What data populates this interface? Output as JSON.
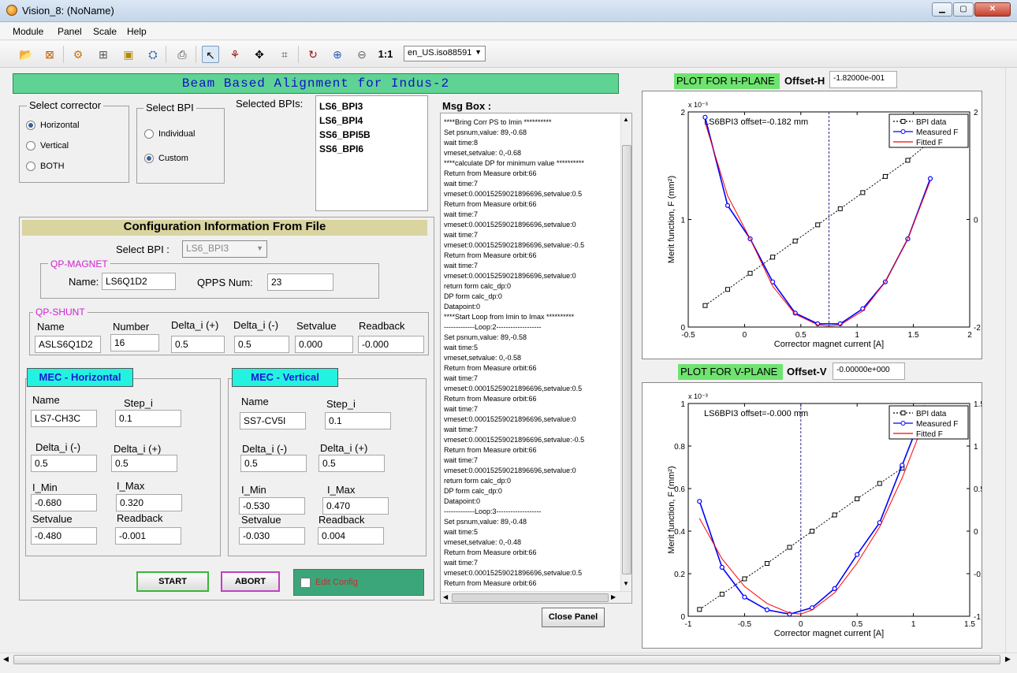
{
  "window": {
    "title": "Vision_8: (NoName)"
  },
  "menu": [
    "Module",
    "Panel",
    "Scale",
    "Help"
  ],
  "toolbar": {
    "zoom_label": "1:1",
    "locale": "en_US.iso88591"
  },
  "header": {
    "title": "Beam Based Alignment for Indus-2"
  },
  "corrector": {
    "title": "Select corrector",
    "options": [
      "Horizontal",
      "Vertical",
      "BOTH"
    ]
  },
  "bpi_select": {
    "title": "Select BPI",
    "options": [
      "Individual",
      "Custom"
    ]
  },
  "selected_bpis": {
    "label": "Selected BPIs:",
    "items": [
      "LS6_BPI3",
      "LS6_BPI4",
      "SS6_BPI5B",
      "SS6_BPI6"
    ]
  },
  "config": {
    "title": "Configuration Information From File",
    "select_bpi_label": "Select BPI :",
    "select_bpi_value": "LS6_BPI3",
    "qp_magnet": {
      "title": "QP-MAGNET",
      "name_label": "Name:",
      "name": "LS6Q1D2",
      "qpps_label": "QPPS Num:",
      "qpps": "23"
    },
    "qp_shunt": {
      "title": "QP-SHUNT",
      "headers": [
        "Name",
        "Number",
        "Delta_i (+)",
        "Delta_i (-)",
        "Setvalue",
        "Readback"
      ],
      "values": [
        "ASLS6Q1D2",
        "16",
        "0.5",
        "0.5",
        "0.000",
        "-0.000"
      ]
    },
    "mec_h": {
      "title": "MEC - Horizontal",
      "name_label": "Name",
      "name": "LS7-CH3C",
      "step_label": "Step_i",
      "step": "0.1",
      "dminus_label": "Delta_i (-)",
      "dminus": "0.5",
      "dplus_label": "Delta_i (+)",
      "dplus": "0.5",
      "imin_label": "I_Min",
      "imin": "-0.680",
      "imax_label": "I_Max",
      "imax": "0.320",
      "set_label": "Setvalue",
      "set": "-0.480",
      "rb_label": "Readback",
      "rb": "-0.001"
    },
    "mec_v": {
      "title": "MEC - Vertical",
      "name_label": "Name",
      "name": "SS7-CV5I",
      "step_label": "Step_i",
      "step": "0.1",
      "dminus_label": "Delta_i (-)",
      "dminus": "0.5",
      "dplus_label": "Delta_i (+)",
      "dplus": "0.5",
      "imin_label": "I_Min",
      "imin": "-0.530",
      "imax_label": "I_Max",
      "imax": "0.470",
      "set_label": "Setvalue",
      "set": "-0.030",
      "rb_label": "Readback",
      "rb": "0.004"
    }
  },
  "actions": {
    "start": "START",
    "abort": "ABORT",
    "edit_config": "Edit Config",
    "close": "Close Panel"
  },
  "msgbox": {
    "label": "Msg Box :",
    "lines": [
      "****Bring Corr PS to Imin **********",
      "Set psnum,value: 89,-0.68",
      "wait time:8",
      "vmeset,setvalue: 0,-0.68",
      "****calculate DP for minimum value **********",
      "Return from Measure orbit:66",
      "wait time:7",
      "vmeset:0.00015259021896696,setvalue:0.5",
      "Return from Measure orbit:66",
      "wait time:7",
      "vmeset:0.00015259021896696,setvalue:0",
      "wait time:7",
      "vmeset:0.00015259021896696,setvalue:-0.5",
      "Return from Measure orbit:66",
      "wait time:7",
      "vmeset:0.00015259021896696,setvalue:0",
      "return form calc_dp:0",
      "DP form calc_dp:0",
      "Datapoint:0",
      "****Start Loop from Imin to Imax **********",
      "-------------Loop:2-------------------",
      "Set psnum,value: 89,-0.58",
      "wait time:5",
      "vmeset,setvalue: 0,-0.58",
      "Return from Measure orbit:66",
      "wait time:7",
      "vmeset:0.00015259021896696,setvalue:0.5",
      "Return from Measure orbit:66",
      "wait time:7",
      "vmeset:0.00015259021896696,setvalue:0",
      "wait time:7",
      "vmeset:0.00015259021896696,setvalue:-0.5",
      "Return from Measure orbit:66",
      "wait time:7",
      "vmeset:0.00015259021896696,setvalue:0",
      "return form calc_dp:0",
      "DP form calc_dp:0",
      "Datapoint:0",
      "-------------Loop:3-------------------",
      "Set psnum,value: 89,-0.48",
      "wait time:5",
      "vmeset,setvalue: 0,-0.48",
      "Return from Measure orbit:66",
      "wait time:7",
      "vmeset:0.00015259021896696,setvalue:0.5",
      "Return from Measure orbit:66"
    ]
  },
  "h_plane": {
    "tag": "PLOT FOR H-PLANE",
    "offset_label": "Offset-H",
    "offset": "-1.82000e-001"
  },
  "v_plane": {
    "tag": "PLOT FOR V-PLANE",
    "offset_label": "Offset-V",
    "offset": "-0.00000e+000"
  },
  "chart_data": [
    {
      "type": "line",
      "annotation": "LS6BPI3 offset=-0.182 mm",
      "xlabel": "Corrector magnet current [A]",
      "ylabel": "Merit function, F (mm²)",
      "y2label": "BPI data [mm]",
      "xlim": [
        -0.5,
        2
      ],
      "ylim": [
        0,
        2
      ],
      "y2lim": [
        -2,
        2
      ],
      "yexp": "x 10⁻³",
      "xticks": [
        "-0.5",
        "0",
        "0.5",
        "1",
        "1.5",
        "2"
      ],
      "yticks": [
        "0",
        "1",
        "2"
      ],
      "y2ticks": [
        "-2",
        "0",
        "2"
      ],
      "offset_x": 0.75,
      "legend": [
        "BPI data",
        "Measured F",
        "Fitted F"
      ],
      "legend_position": "top-right",
      "colors": {
        "bpi": "#000000",
        "measured": "#0000ff",
        "fitted": "#ff0000"
      },
      "series": [
        {
          "name": "BPI data",
          "axis": "y2",
          "x": [
            -0.35,
            -0.15,
            0.05,
            0.25,
            0.45,
            0.65,
            0.85,
            1.05,
            1.25,
            1.45,
            1.65
          ],
          "y": [
            -1.6,
            -1.3,
            -1.0,
            -0.7,
            -0.4,
            -0.1,
            0.2,
            0.5,
            0.8,
            1.1,
            1.45
          ]
        },
        {
          "name": "Measured F",
          "axis": "y",
          "x": [
            -0.35,
            -0.15,
            0.05,
            0.25,
            0.45,
            0.65,
            0.85,
            1.05,
            1.25,
            1.45,
            1.65
          ],
          "y": [
            1.95,
            1.13,
            0.82,
            0.42,
            0.13,
            0.03,
            0.03,
            0.17,
            0.42,
            0.82,
            1.38
          ]
        },
        {
          "name": "Fitted F",
          "axis": "y",
          "x": [
            -0.35,
            -0.15,
            0.05,
            0.25,
            0.45,
            0.65,
            0.75,
            0.85,
            1.05,
            1.25,
            1.45,
            1.65
          ],
          "y": [
            1.9,
            1.22,
            0.82,
            0.38,
            0.12,
            0.02,
            0.01,
            0.02,
            0.15,
            0.42,
            0.82,
            1.36
          ]
        }
      ]
    },
    {
      "type": "line",
      "annotation": "LS6BPI3 offset=-0.000 mm",
      "xlabel": "Corrector magnet current [A]",
      "ylabel": "Merit function, F (mm²)",
      "y2label": "BPI data [mm]",
      "xlim": [
        -1,
        1.5
      ],
      "ylim": [
        0,
        1
      ],
      "y2lim": [
        -1,
        1.5
      ],
      "yexp": "x 10⁻³",
      "xticks": [
        "-1",
        "-0.5",
        "0",
        "0.5",
        "1",
        "1.5"
      ],
      "yticks": [
        "0",
        "0.2",
        "0.4",
        "0.6",
        "0.8",
        "1"
      ],
      "y2ticks": [
        "-1",
        "-0.5",
        "0",
        "0.5",
        "1",
        "1.5"
      ],
      "offset_x": 0,
      "legend": [
        "BPI data",
        "Measured F",
        "Fitted F"
      ],
      "legend_position": "top-right",
      "colors": {
        "bpi": "#000000",
        "measured": "#0000ff",
        "fitted": "#ff0000"
      },
      "series": [
        {
          "name": "BPI data",
          "axis": "y2",
          "x": [
            -0.9,
            -0.7,
            -0.5,
            -0.3,
            -0.1,
            0.1,
            0.3,
            0.5,
            0.7,
            0.9
          ],
          "y": [
            -0.92,
            -0.74,
            -0.56,
            -0.38,
            -0.19,
            0.0,
            0.19,
            0.38,
            0.56,
            0.74
          ]
        },
        {
          "name": "Measured F",
          "axis": "y",
          "x": [
            -0.9,
            -0.7,
            -0.5,
            -0.3,
            -0.1,
            0.1,
            0.3,
            0.5,
            0.7,
            0.9,
            1.1
          ],
          "y": [
            0.54,
            0.23,
            0.09,
            0.03,
            0.01,
            0.04,
            0.13,
            0.29,
            0.44,
            0.71,
            0.98
          ]
        },
        {
          "name": "Fitted F",
          "axis": "y",
          "x": [
            -0.9,
            -0.7,
            -0.5,
            -0.3,
            -0.1,
            0.0,
            0.1,
            0.3,
            0.5,
            0.7,
            0.9,
            1.1
          ],
          "y": [
            0.46,
            0.27,
            0.14,
            0.06,
            0.015,
            0.01,
            0.03,
            0.11,
            0.25,
            0.42,
            0.65,
            0.92
          ]
        }
      ]
    }
  ]
}
